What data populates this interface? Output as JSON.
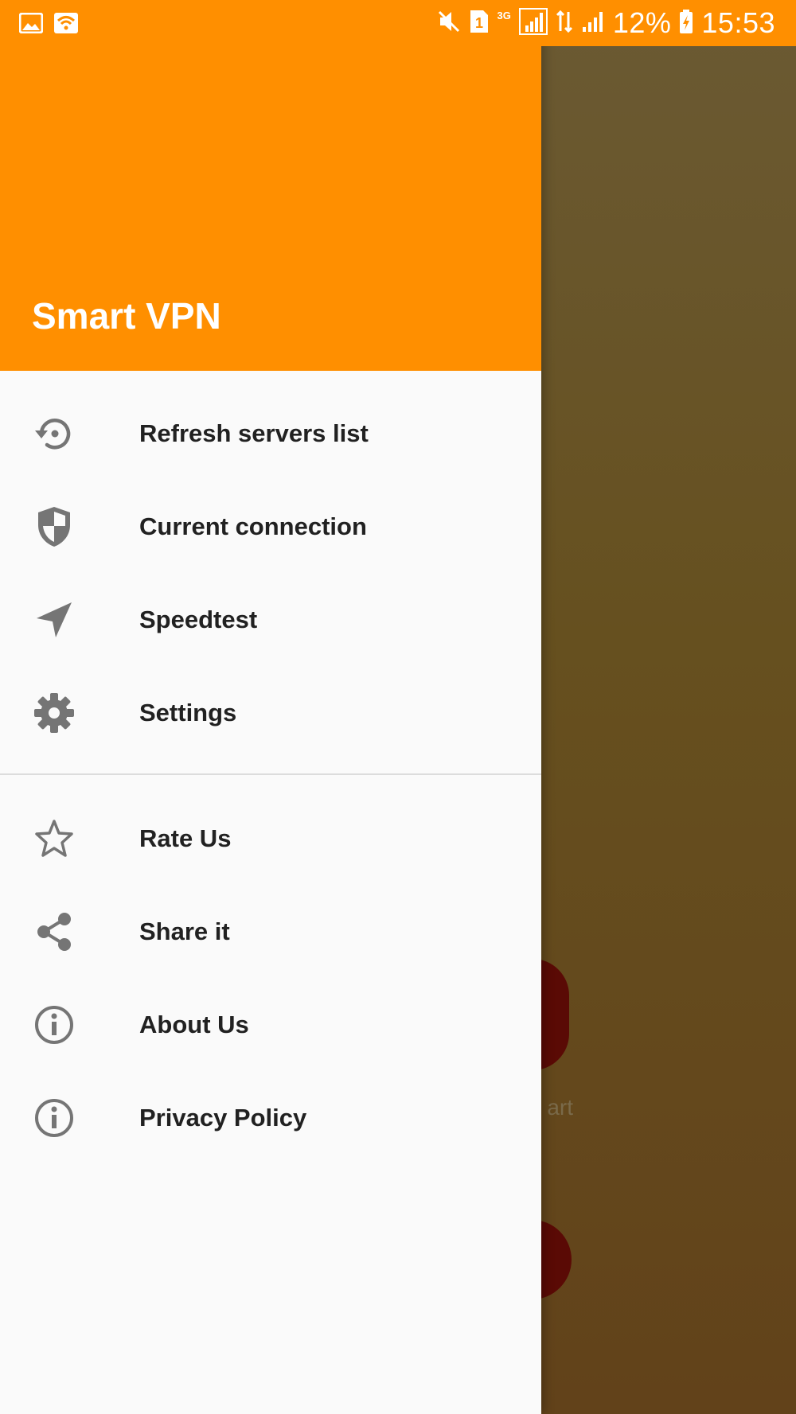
{
  "status_bar": {
    "network_label": "3G",
    "battery_percent": "12%",
    "time": "15:53",
    "icons": [
      "gallery-icon",
      "wifi-notification-icon",
      "mute-icon",
      "sim-1-icon",
      "signal-icon",
      "data-arrows-icon",
      "signal-2-icon",
      "charging-battery-icon"
    ]
  },
  "drawer": {
    "title": "Smart VPN",
    "colors": {
      "header": "#ff8f00",
      "icon": "#757575",
      "text": "#212121"
    },
    "items": [
      {
        "label": "Refresh servers list",
        "icon": "history-refresh-icon"
      },
      {
        "label": "Current connection",
        "icon": "shield-icon"
      },
      {
        "label": "Speedtest",
        "icon": "navigation-arrow-icon"
      },
      {
        "label": "Settings",
        "icon": "gear-icon"
      }
    ],
    "secondary_items": [
      {
        "label": "Rate Us",
        "icon": "star-outline-icon"
      },
      {
        "label": "Share it",
        "icon": "share-icon"
      },
      {
        "label": "About Us",
        "icon": "info-icon"
      },
      {
        "label": "Privacy Policy",
        "icon": "info-icon"
      }
    ]
  },
  "background": {
    "connect_label_fragment": "art"
  }
}
